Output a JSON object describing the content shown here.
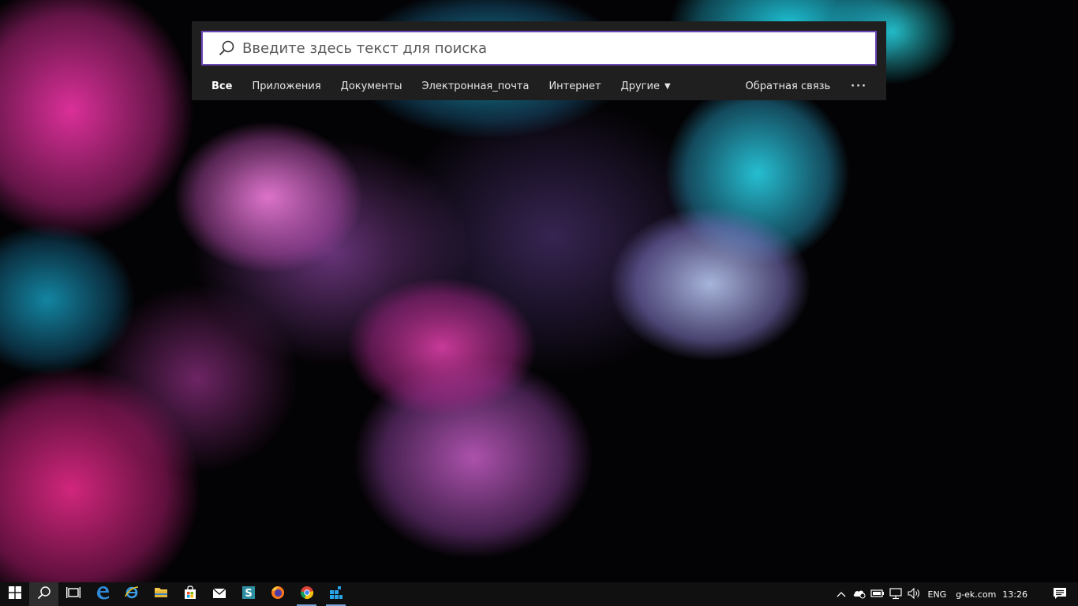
{
  "search": {
    "placeholder": "Введите здесь текст для поиска",
    "value": ""
  },
  "filters": {
    "items": [
      {
        "label": "Все",
        "active": true
      },
      {
        "label": "Приложения"
      },
      {
        "label": "Документы"
      },
      {
        "label": "Электронная_почта"
      },
      {
        "label": "Интернет"
      },
      {
        "label": "Другие"
      }
    ],
    "feedback": "Обратная связь",
    "more": "···"
  },
  "taskbar": {
    "apps": [
      {
        "icon": "windows-start-icon"
      },
      {
        "icon": "search-icon",
        "active": true
      },
      {
        "icon": "task-view-icon"
      },
      {
        "icon": "edge-icon"
      },
      {
        "icon": "internet-explorer-icon"
      },
      {
        "icon": "file-explorer-icon"
      },
      {
        "icon": "store-icon"
      },
      {
        "icon": "mail-icon"
      },
      {
        "icon": "sway-icon"
      },
      {
        "icon": "firefox-icon"
      },
      {
        "icon": "chrome-icon",
        "running": true
      },
      {
        "icon": "tiles-app-icon",
        "running": true
      }
    ],
    "tray": {
      "language": "ENG",
      "site": "g-ek.com",
      "time": "13:26"
    }
  },
  "colors": {
    "accent": "#6b47b8",
    "panel": "#1f1f1f",
    "taskbar": "#101010",
    "running_indicator": "#7aa6d6"
  }
}
